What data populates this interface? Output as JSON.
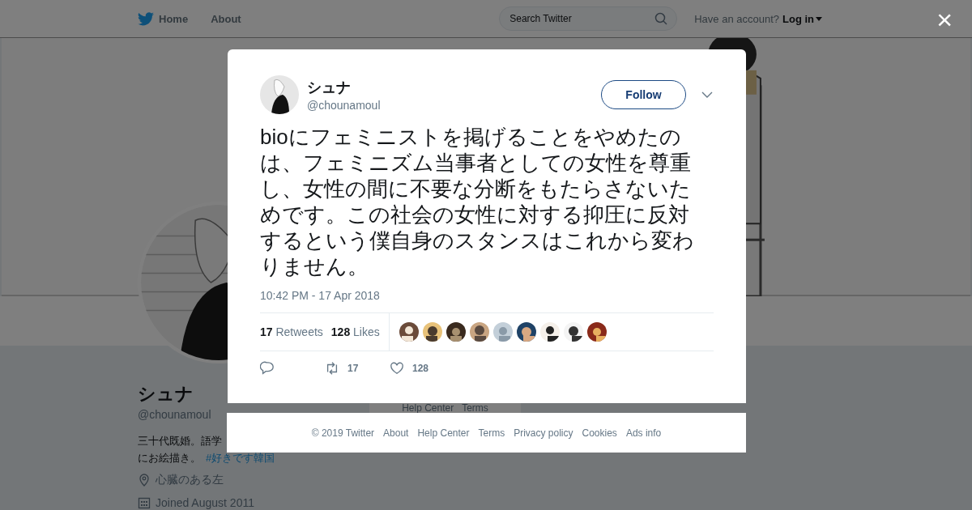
{
  "header": {
    "nav": [
      {
        "label": "Home",
        "kind": "home"
      },
      {
        "label": "About",
        "kind": "plain"
      }
    ],
    "search": {
      "placeholder": "Search Twitter"
    },
    "account_prompt": "Have an account?",
    "login": "Log in"
  },
  "banner": {
    "kind": "picture"
  },
  "profile": {
    "avatar": {
      "kind": "picture"
    },
    "name": "シュナ",
    "handle": "@chounamoul",
    "bio": [
      "三十代既婚。語学",
      "にお絵描き。"
    ],
    "hashtag": "#好きです韓国",
    "location": "心臓のある左",
    "joined": "Joined August 2011"
  },
  "background_footer": [
    "Help Center",
    "Terms"
  ],
  "close": "×",
  "tweet": {
    "author": {
      "name": "シュナ",
      "handle": "@chounamoul"
    },
    "follow_button": "Follow",
    "text": "bioにフェミニストを掲げることをやめたのは、フェミニズム当事者としての女性を尊重し、女性の間に不要な分断をもたらさないためです。この社会の女性に対する抑圧に反対するという僕自身のスタンスはこれから変わりません。",
    "time": "10:42 PM - 17 Apr 2018",
    "stats": [
      {
        "count": "17",
        "label": "Retweets"
      },
      {
        "count": "128",
        "label": "Likes"
      }
    ],
    "likers": [
      {
        "kind": "picture"
      },
      {
        "kind": "picture"
      },
      {
        "kind": "picture"
      },
      {
        "kind": "picture"
      },
      {
        "kind": "picture"
      },
      {
        "kind": "picture"
      },
      {
        "kind": "picture"
      },
      {
        "kind": "picture"
      },
      {
        "kind": "picture"
      }
    ],
    "actions": [
      {
        "kind": "reply"
      },
      {
        "kind": "retweet",
        "count": "17"
      },
      {
        "kind": "like",
        "count": "128"
      }
    ]
  },
  "footer": [
    "© 2019 Twitter",
    "About",
    "Help Center",
    "Terms",
    "Privacy policy",
    "Cookies",
    "Ads info"
  ]
}
